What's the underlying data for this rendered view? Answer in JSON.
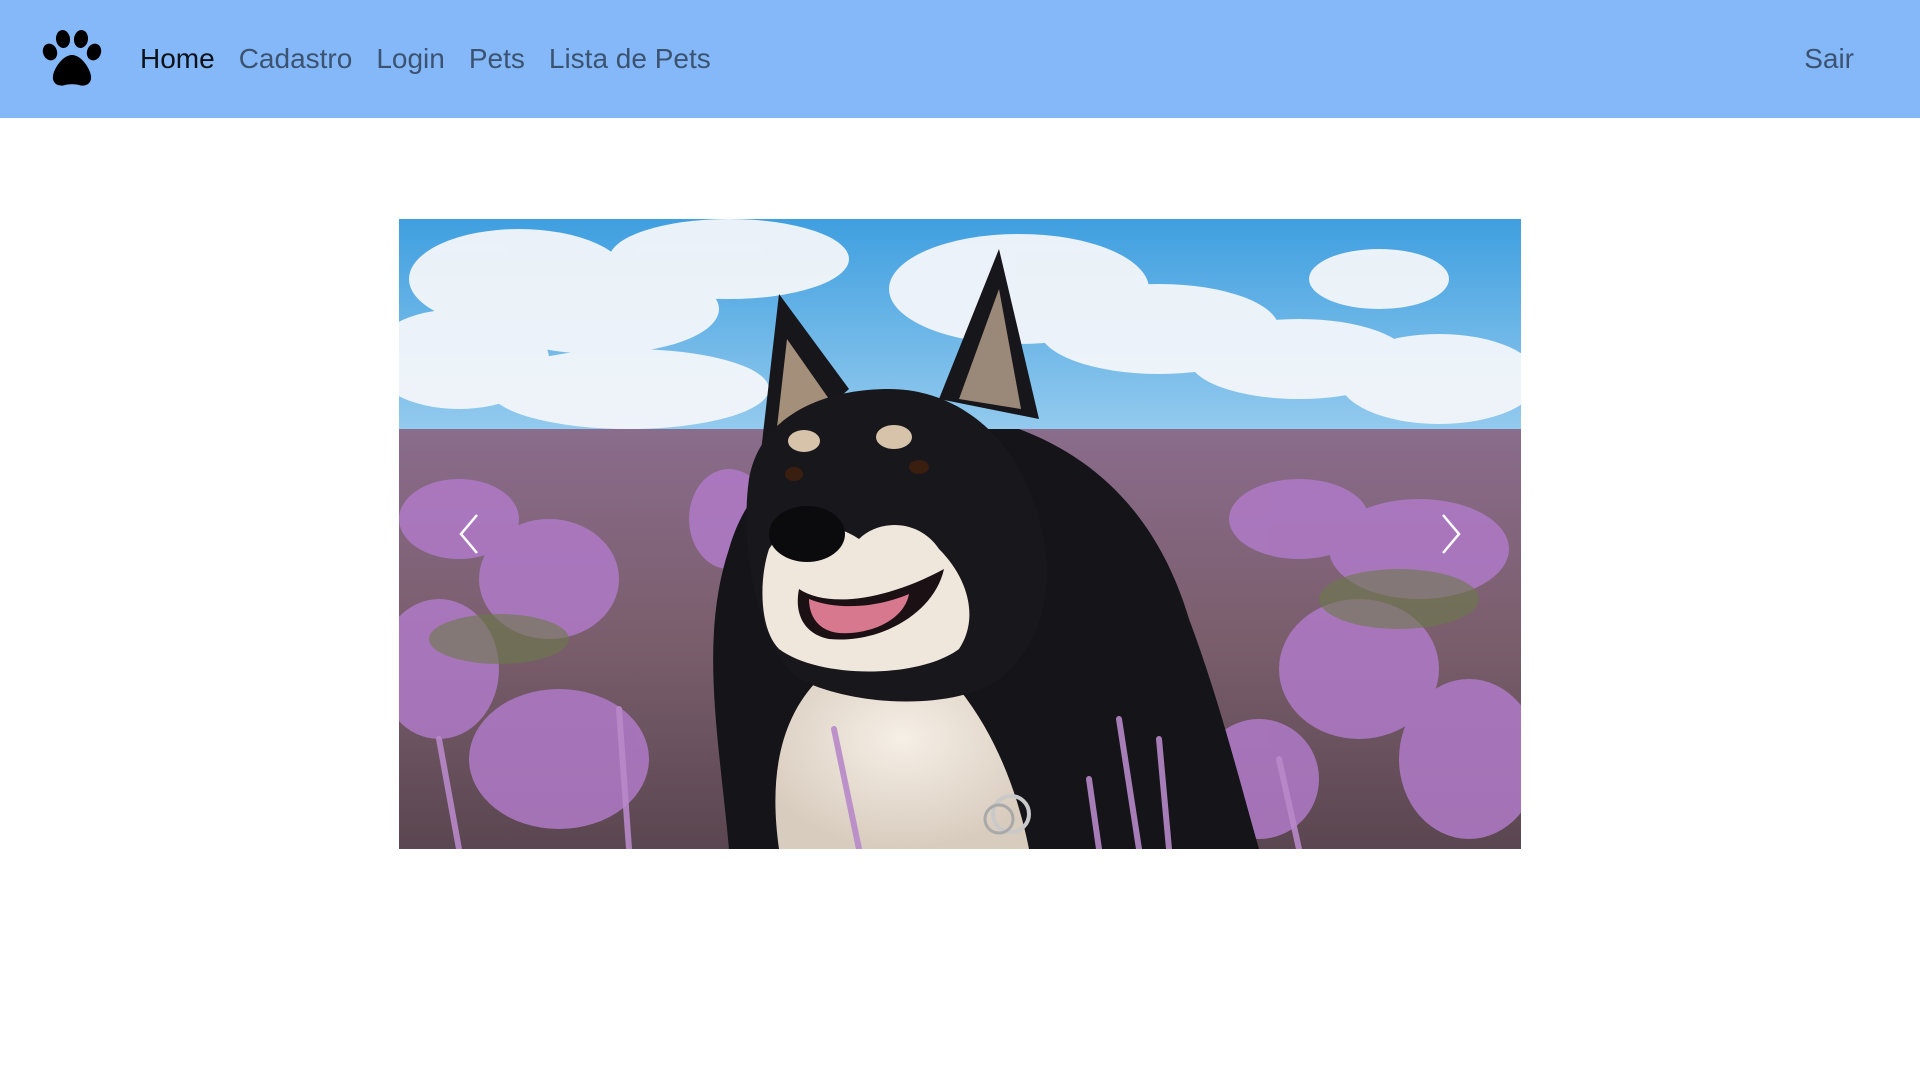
{
  "navbar": {
    "brand_icon": "paw-icon",
    "links": [
      {
        "label": "Home",
        "active": true
      },
      {
        "label": "Cadastro",
        "active": false
      },
      {
        "label": "Login",
        "active": false
      },
      {
        "label": "Pets",
        "active": false
      },
      {
        "label": "Lista de Pets",
        "active": false
      }
    ],
    "right_link": "Sair"
  },
  "carousel": {
    "slide_image": "dog-in-heather-field-photo",
    "prev_icon": "chevron-left-icon",
    "next_icon": "chevron-right-icon"
  },
  "colors": {
    "navbar_bg": "#84b8f9",
    "page_bg": "#ffffff"
  }
}
